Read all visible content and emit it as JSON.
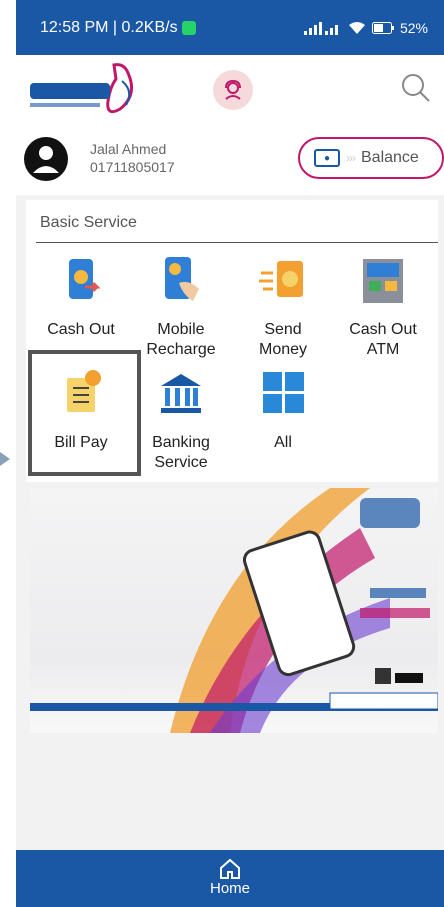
{
  "status_bar": {
    "time_speed": "12:58 PM | 0.2KB/s",
    "battery": "52%"
  },
  "header": {
    "logo_icon": "telecash-logo",
    "support_icon": "support-agent-icon",
    "search_icon": "search-icon"
  },
  "user": {
    "name": "Jalal Ahmed",
    "phone": "01711805017",
    "balance_label": "Balance"
  },
  "services": {
    "title": "Basic Service",
    "items": [
      {
        "label": "Cash Out",
        "icon": "cash-out-icon"
      },
      {
        "label": "Mobile\nRecharge",
        "icon": "mobile-recharge-icon"
      },
      {
        "label": "Send\nMoney",
        "icon": "send-money-icon"
      },
      {
        "label": "Cash Out\nATM",
        "icon": "atm-icon"
      },
      {
        "label": "Bill Pay",
        "icon": "bill-pay-icon"
      },
      {
        "label": "Banking\nService",
        "icon": "bank-icon"
      },
      {
        "label": "All",
        "icon": "grid-icon"
      }
    ]
  },
  "nav": {
    "home_label": "Home"
  },
  "colors": {
    "primary": "#1a57a5",
    "accent": "#c0176a"
  }
}
